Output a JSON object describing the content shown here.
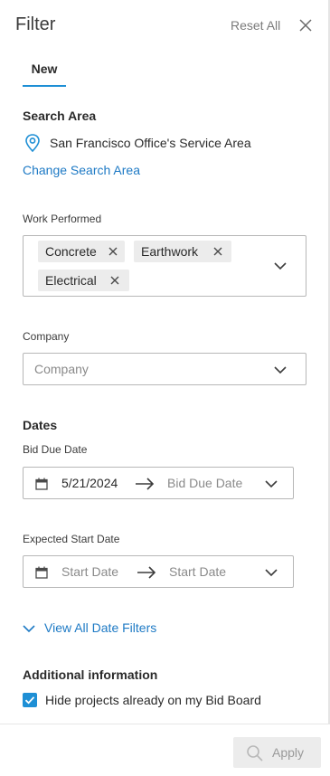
{
  "header": {
    "title": "Filter",
    "reset_label": "Reset All"
  },
  "tabs": [
    {
      "label": "New",
      "active": true
    }
  ],
  "search_area": {
    "title": "Search Area",
    "location": "San Francisco Office's Service Area",
    "change_link": "Change Search Area"
  },
  "work_performed": {
    "label": "Work Performed",
    "chips": [
      "Concrete",
      "Earthwork",
      "Electrical"
    ]
  },
  "company": {
    "label": "Company",
    "placeholder": "Company"
  },
  "dates": {
    "title": "Dates",
    "bid_due": {
      "label": "Bid Due Date",
      "start": "5/21/2024",
      "end_placeholder": "Bid Due Date"
    },
    "expected_start": {
      "label": "Expected Start Date",
      "start_placeholder": "Start Date",
      "end_placeholder": "Start Date"
    },
    "view_all_link": "View All Date Filters"
  },
  "additional": {
    "title": "Additional information",
    "hide_checkbox": {
      "label": "Hide projects already on my Bid Board",
      "checked": true
    }
  },
  "footer": {
    "apply_label": "Apply"
  },
  "colors": {
    "accent": "#1e8fd5",
    "link": "#1e7ac5",
    "border": "#b7b7b7",
    "chip_bg": "#ececec"
  }
}
